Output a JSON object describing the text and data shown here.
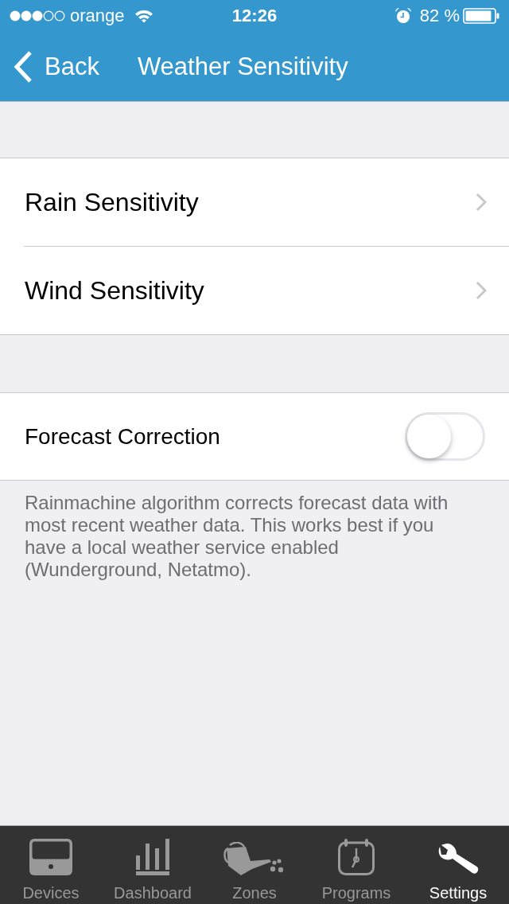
{
  "status_bar": {
    "carrier": "orange",
    "time": "12:26",
    "battery": "82 %"
  },
  "nav_bar": {
    "back": "Back",
    "title": "Weather Sensitivity"
  },
  "sections": [
    {
      "rows": [
        {
          "kind": "link",
          "label": "Rain Sensitivity"
        },
        {
          "kind": "link",
          "label": "Wind Sensitivity"
        }
      ]
    },
    {
      "rows": [
        {
          "kind": "toggle",
          "label": "Forecast Correction",
          "on": false
        }
      ],
      "footer": "Rainmachine algorithm corrects forecast data with most recent weather data. This works best if you have a local weather service enabled (Wunderground, Netatmo)."
    }
  ],
  "tab_bar": [
    {
      "label": "Devices",
      "selected": false
    },
    {
      "label": "Dashboard",
      "selected": false
    },
    {
      "label": "Zones",
      "selected": false
    },
    {
      "label": "Programs",
      "selected": false
    },
    {
      "label": "Settings",
      "selected": true
    }
  ]
}
